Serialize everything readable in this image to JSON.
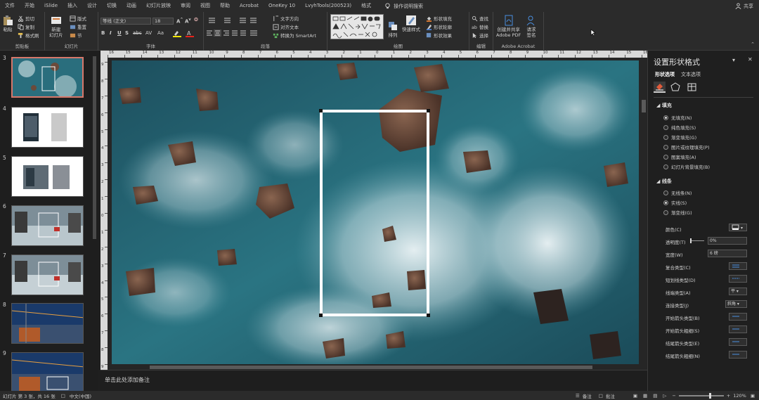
{
  "menu": {
    "items": [
      "文件",
      "开始",
      "iSlide",
      "插入",
      "设计",
      "切换",
      "动画",
      "幻灯片放映",
      "审阅",
      "视图",
      "帮助",
      "Acrobat",
      "OneKey 10",
      "LvyhTools(200523)",
      "格式"
    ],
    "tell_me": "操作说明搜索",
    "share": "共享"
  },
  "ribbon": {
    "clipboard": {
      "paste": "粘贴",
      "cut": "剪切",
      "copy": "复制",
      "format_painter": "格式刷",
      "label": "剪贴板"
    },
    "slides": {
      "new_slide": "新建\n幻灯片",
      "layout": "版式",
      "reset": "重置",
      "section": "节",
      "label": "幻灯片"
    },
    "font": {
      "font_name": "等线 (正文)",
      "font_size": "18",
      "bold": "B",
      "italic": "I",
      "underline": "U",
      "shadow": "S",
      "strike": "abc",
      "spacing": "AV",
      "case": "Aa",
      "label": "字体"
    },
    "paragraph": {
      "text_direction": "文字方向",
      "align_text": "对齐文本",
      "smartart": "转换为 SmartArt",
      "label": "段落"
    },
    "drawing": {
      "arrange": "排列",
      "quick_styles": "快速样式",
      "shape_fill": "形状填充",
      "shape_outline": "形状轮廓",
      "shape_effects": "形状效果",
      "label": "绘图"
    },
    "editing": {
      "find": "查找",
      "replace": "替换",
      "select": "选择",
      "label": "编辑"
    },
    "acrobat": {
      "create_pdf": "创建并共享\nAdobe PDF",
      "request_sign": "请求\n签名",
      "label": "Adobe Acrobat"
    }
  },
  "ruler": {
    "h_numbers": [
      "16",
      "15",
      "14",
      "13",
      "12",
      "11",
      "10",
      "9",
      "8",
      "7",
      "6",
      "5",
      "4",
      "3",
      "2",
      "1",
      "0",
      "1",
      "2",
      "3",
      "4",
      "5",
      "6",
      "7",
      "8",
      "9",
      "10",
      "11",
      "12",
      "13",
      "14",
      "15",
      "16"
    ],
    "v_numbers": [
      "9",
      "8",
      "7",
      "6",
      "5",
      "4",
      "3",
      "2",
      "1",
      "0",
      "1",
      "2",
      "3",
      "4",
      "5",
      "6",
      "7",
      "8",
      "9"
    ]
  },
  "thumbnails": {
    "numbers": [
      "3",
      "4",
      "5",
      "6",
      "7",
      "8",
      "9"
    ],
    "selected": "3"
  },
  "notes": {
    "placeholder": "单击此处添加备注"
  },
  "status": {
    "slide_info": "幻灯片 第 3 张，共 16 张",
    "language": "中文(中国)",
    "notes": "备注",
    "comments": "批注",
    "zoom": "120%",
    "zoom_fraction": 0.7
  },
  "pane": {
    "title": "设置形状格式",
    "tabs": [
      "形状选项",
      "文本选项"
    ],
    "fill": {
      "section": "填充",
      "options": [
        "无填充(N)",
        "纯色填充(S)",
        "渐变填充(G)",
        "图片或纹理填充(P)",
        "图案填充(A)",
        "幻灯片背景填充(B)"
      ],
      "selected_index": 0
    },
    "line": {
      "section": "线条",
      "options": [
        "无线条(N)",
        "实线(S)",
        "渐变线(G)"
      ],
      "selected_index": 1
    },
    "props": {
      "color": "颜色(C)",
      "transparency": "透明度(T)",
      "transparency_value": "0%",
      "width": "宽度(W)",
      "width_value": "6 磅",
      "compound": "复合类型(C)",
      "dash": "短划线类型(D)",
      "cap": "线端类型(A)",
      "cap_value": "平",
      "join": "连接类型(J)",
      "join_value": "斜角",
      "begin_arrow_type": "开始箭头类型(B)",
      "begin_arrow_size": "开始箭头粗细(S)",
      "end_arrow_type": "结尾箭头类型(E)",
      "end_arrow_size": "结尾箭头粗细(N)"
    }
  },
  "colors": {
    "app_bg": "#1f1f1f",
    "ribbon_bg": "#2b2b2b",
    "selection_accent": "#d6776a",
    "ocean_deep": "#1f5565",
    "ocean_teal": "#2b7a86",
    "foam": "#d8e6ea",
    "rock": "#6b4a3a"
  }
}
